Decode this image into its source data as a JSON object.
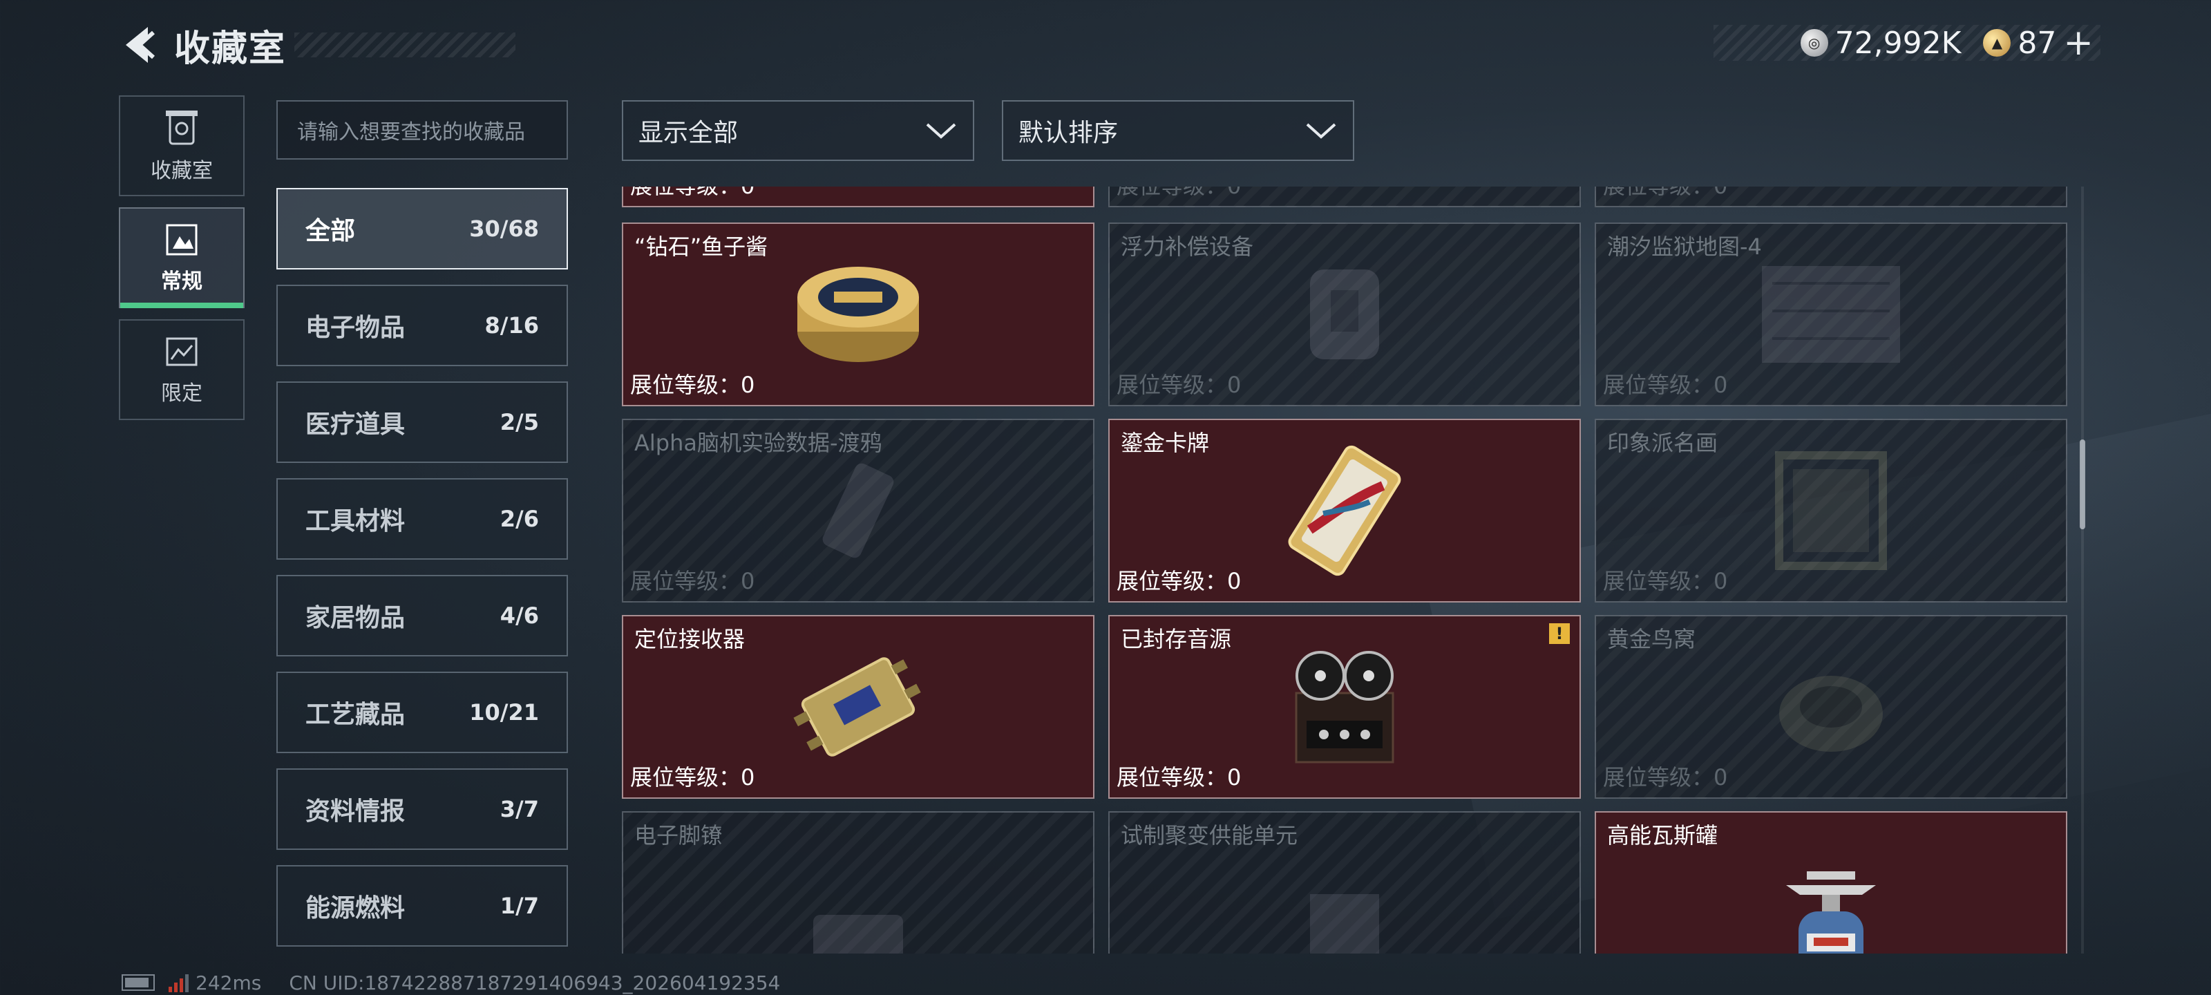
{
  "header": {
    "title": "收藏室"
  },
  "currency": {
    "silver": "72,992K",
    "gold": "87",
    "add": "+"
  },
  "modes": [
    {
      "label": "收藏室",
      "icon": "vault-icon"
    },
    {
      "label": "常规",
      "icon": "regular-icon"
    },
    {
      "label": "限定",
      "icon": "limited-icon"
    }
  ],
  "search": {
    "placeholder": "请输入想要查找的收藏品"
  },
  "categories": [
    {
      "name": "全部",
      "count": "30/68"
    },
    {
      "name": "电子物品",
      "count": "8/16"
    },
    {
      "name": "医疗道具",
      "count": "2/5"
    },
    {
      "name": "工具材料",
      "count": "2/6"
    },
    {
      "name": "家居物品",
      "count": "4/6"
    },
    {
      "name": "工艺藏品",
      "count": "10/21"
    },
    {
      "name": "资料情报",
      "count": "3/7"
    },
    {
      "name": "能源燃料",
      "count": "1/7"
    }
  ],
  "filters": {
    "show": "显示全部",
    "sort": "默认排序"
  },
  "level_prefix": "展位等级：",
  "grid": {
    "row0_level": "展位等级：0",
    "items": [
      {
        "name": "“钻石”鱼子酱",
        "level": "展位等级：0",
        "owned": true,
        "icon": "caviar-icon"
      },
      {
        "name": "浮力补偿设备",
        "level": "展位等级：0",
        "owned": false,
        "icon": "bcd-icon"
      },
      {
        "name": "潮汐监狱地图-4",
        "level": "展位等级：0",
        "owned": false,
        "icon": "map-icon"
      },
      {
        "name": "Alpha脑机实验数据-渡鸦",
        "level": "展位等级：0",
        "owned": false,
        "icon": "data-icon"
      },
      {
        "name": "鎏金卡牌",
        "level": "展位等级：0",
        "owned": true,
        "icon": "gold-card-icon"
      },
      {
        "name": "印象派名画",
        "level": "展位等级：0",
        "owned": false,
        "icon": "painting-icon"
      },
      {
        "name": "定位接收器",
        "level": "展位等级：0",
        "owned": true,
        "icon": "receiver-icon"
      },
      {
        "name": "已封存音源",
        "level": "展位等级：0",
        "owned": true,
        "icon": "reel-recorder-icon",
        "warn": "!"
      },
      {
        "name": "黄金鸟窝",
        "level": "展位等级：0",
        "owned": false,
        "icon": "nest-icon"
      },
      {
        "name": "电子脚镣",
        "level": "",
        "owned": false,
        "icon": "ankle-monitor-icon"
      },
      {
        "name": "试制聚变供能单元",
        "level": "",
        "owned": false,
        "icon": "fusion-unit-icon"
      },
      {
        "name": "高能瓦斯罐",
        "level": "",
        "owned": true,
        "icon": "gas-canister-icon"
      }
    ]
  },
  "footer": {
    "ping": "242ms",
    "uid": "CN UID:187422887187291406943_202604192354"
  }
}
